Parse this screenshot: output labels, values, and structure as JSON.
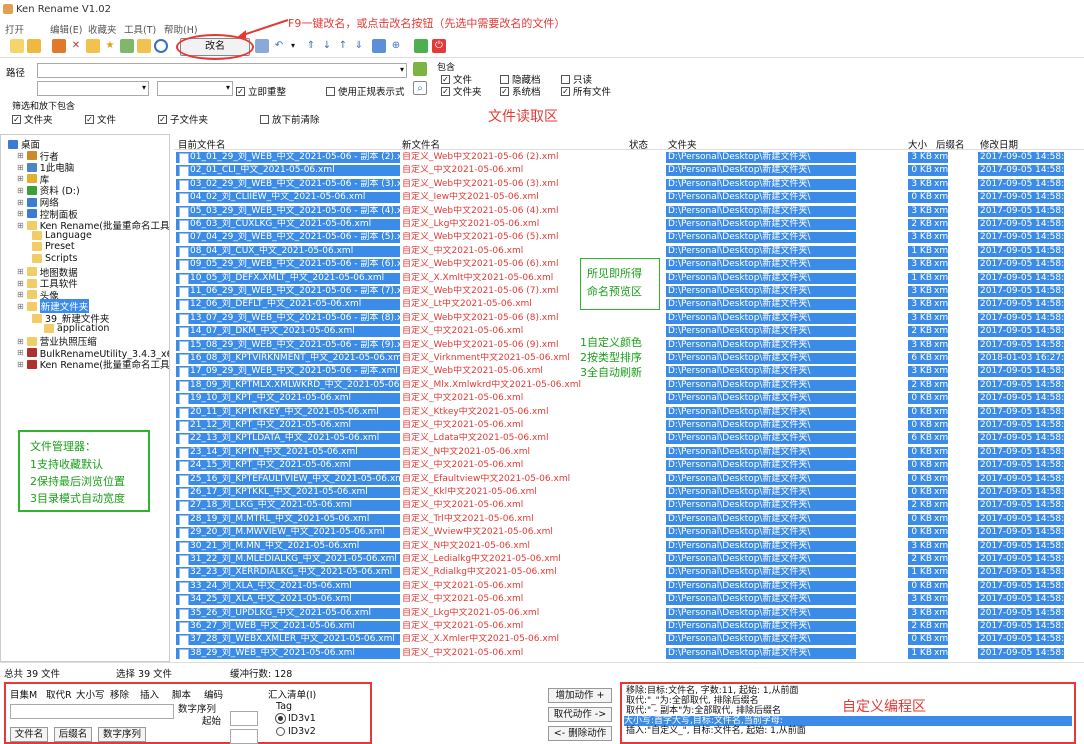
{
  "window": {
    "title": "Ken Rename V1.02"
  },
  "menu": [
    "打开",
    "编辑(E)",
    "收藏夹",
    "工具(T)",
    "帮助(H)"
  ],
  "toolbar": {
    "rename_label": "改名"
  },
  "callouts": {
    "f9": "F9一键改名，或点击改名按钮（先选中需要改名的文件）",
    "read_area": "文件读取区",
    "preview": [
      "所见即所得",
      "命名预览区"
    ],
    "features": [
      "1自定义颜色",
      "2按类型排序",
      "3全自动刷新"
    ],
    "filemgr": [
      "文件管理器：",
      "1支持收藏默认",
      "2保持最后浏览位置",
      "3目录模式自动宽度"
    ],
    "prog_area": "自定义编程区"
  },
  "filter": {
    "path_label": "路径",
    "include_label": "包含",
    "refresh_label": "立即重整",
    "regex_label": "使用正规表示式",
    "sub_include_label": "筛选和放下包含",
    "files_label": "文件夹",
    "file_label": "文件",
    "subfolder_label": "子文件夹",
    "clear_label": "放下前清除",
    "inc_file": "文件",
    "inc_folder": "文件夹",
    "hidden": "隐藏档",
    "system": "系统档",
    "readonly": "只读",
    "allfiles": "所有文件"
  },
  "tree": [
    {
      "label": "桌面",
      "indent": 0,
      "color": "#3b7bd6"
    },
    {
      "label": "行者",
      "indent": 1,
      "color": "#c98a2c"
    },
    {
      "label": "1此电脑",
      "indent": 1,
      "color": "#4a86c8"
    },
    {
      "label": "库",
      "indent": 1,
      "color": "#e0b030"
    },
    {
      "label": "资料 (D:)",
      "indent": 1,
      "color": "#3aa03a"
    },
    {
      "label": "网络",
      "indent": 1,
      "color": "#3b7bd6"
    },
    {
      "label": "控制面板",
      "indent": 1,
      "color": "#3b7bd6"
    },
    {
      "label": "Ken Rename(批量重命名工具中文",
      "indent": 1,
      "color": "#f2cc66"
    },
    {
      "label": "Language",
      "indent": 2,
      "color": "#f2cc66"
    },
    {
      "label": "Preset",
      "indent": 2,
      "color": "#f2cc66"
    },
    {
      "label": "Scripts",
      "indent": 2,
      "color": "#f2cc66"
    },
    {
      "label": "地图数据",
      "indent": 1,
      "color": "#f2cc66"
    },
    {
      "label": "工具软件",
      "indent": 1,
      "color": "#f2cc66"
    },
    {
      "label": "头像",
      "indent": 1,
      "color": "#f2cc66"
    },
    {
      "label": "新建文件夹",
      "indent": 1,
      "color": "#f2cc66",
      "sel": true
    },
    {
      "label": "39_新建文件夹",
      "indent": 2,
      "color": "#f2cc66"
    },
    {
      "label": "application",
      "indent": 3,
      "color": "#f2cc66"
    },
    {
      "label": "营业执照压缩",
      "indent": 1,
      "color": "#f2cc66"
    },
    {
      "label": "BulkRenameUtility_3.4.3_x64(绿",
      "indent": 1,
      "color": "#b03030"
    },
    {
      "label": "Ken Rename(批量重命名工具中文",
      "indent": 1,
      "color": "#b03030"
    }
  ],
  "columns": {
    "old": "目前文件名",
    "new": "新文件名",
    "state": "状态",
    "dir": "文件夹",
    "size": "大小",
    "ext": "后缀名",
    "date": "修改日期"
  },
  "rows": [
    [
      "01_01_29_刘_WEB_中文_2021-05-06 - 副本 (2).xml",
      "自定义_Web中文2021-05-06 (2).xml",
      "3 KB",
      "2017-09-05 14:58:3"
    ],
    [
      "02_01_CLI_中文_2021-05-06.xml",
      "自定义_中文2021-05-06.xml",
      "0 KB",
      "2017-09-05 14:58:3"
    ],
    [
      "03_02_29_刘_WEB_中文_2021-05-06 - 副本 (3).xml",
      "自定义_Web中文2021-05-06 (3).xml",
      "3 KB",
      "2017-09-05 14:58:3"
    ],
    [
      "04_02_刘_CLIIEW_中文_2021-05-06.xml",
      "自定义_Iew中文2021-05-06.xml",
      "0 KB",
      "2017-09-05 14:58:3"
    ],
    [
      "05_03_29_刘_WEB_中文_2021-05-06 - 副本 (4).xml",
      "自定义_Web中文2021-05-06 (4).xml",
      "3 KB",
      "2017-09-05 14:58:3"
    ],
    [
      "06_03_刘_CUXLKG_中文_2021-05-06.xml",
      "自定义_Lkg中文2021-05-06.xml",
      "2 KB",
      "2017-09-05 14:58:3"
    ],
    [
      "07_04_29_刘_WEB_中文_2021-05-06 - 副本 (5).xml",
      "自定义_Web中文2021-05-06 (5).xml",
      "3 KB",
      "2017-09-05 14:58:3"
    ],
    [
      "08_04_刘_CUX_中文_2021-05-06.xml",
      "自定义_中文2021-05-06.xml",
      "1 KB",
      "2017-09-05 14:58:3"
    ],
    [
      "09_05_29_刘_WEB_中文_2021-05-06 - 副本 (6).xml",
      "自定义_Web中文2021-05-06 (6).xml",
      "3 KB",
      "2017-09-05 14:58:3"
    ],
    [
      "10_05_刘_DEFX.XMLT_中文_2021-05-06.xml",
      "自定义_X.Xmlt中文2021-05-06.xml",
      "1 KB",
      "2017-09-05 14:58:3"
    ],
    [
      "11_06_29_刘_WEB_中文_2021-05-06 - 副本 (7).xml",
      "自定义_Web中文2021-05-06 (7).xml",
      "3 KB",
      "2017-09-05 14:58:3"
    ],
    [
      "12_06_刘_DEFLT_中文_2021-05-06.xml",
      "自定义_Lt中文2021-05-06.xml",
      "3 KB",
      "2017-09-05 14:58:3"
    ],
    [
      "13_07_29_刘_WEB_中文_2021-05-06 - 副本 (8).xml",
      "自定义_Web中文2021-05-06 (8).xml",
      "3 KB",
      "2017-09-05 14:58:3"
    ],
    [
      "14_07_刘_DKM_中文_2021-05-06.xml",
      "自定义_中文2021-05-06.xml",
      "2 KB",
      "2017-09-05 14:58:3"
    ],
    [
      "15_08_29_刘_WEB_中文_2021-05-06 - 副本 (9).xml",
      "自定义_Web中文2021-05-06 (9).xml",
      "3 KB",
      "2017-09-05 14:58:3"
    ],
    [
      "16_08_刘_KPTVIRKNMENT_中文_2021-05-06.xml",
      "自定义_Virknment中文2021-05-06.xml",
      "6 KB",
      "2018-01-03 16:27:2"
    ],
    [
      "17_09_29_刘_WEB_中文_2021-05-06 - 副本.xml",
      "自定义_Web中文2021-05-06.xml",
      "3 KB",
      "2017-09-05 14:58:3"
    ],
    [
      "18_09_刘_KPTMLX.XMLWKRD_中文_2021-05-06.xml",
      "自定义_Mlx.Xmlwkrd中文2021-05-06.xml",
      "2 KB",
      "2017-09-05 14:58:3"
    ],
    [
      "19_10_刘_KPT_中文_2021-05-06.xml",
      "自定义_中文2021-05-06.xml",
      "0 KB",
      "2017-09-05 14:58:3"
    ],
    [
      "20_11_刘_KPTKTKEY_中文_2021-05-06.xml",
      "自定义_Ktkey中文2021-05-06.xml",
      "0 KB",
      "2017-09-05 14:58:3"
    ],
    [
      "21_12_刘_KPT_中文_2021-05-06.xml",
      "自定义_中文2021-05-06.xml",
      "0 KB",
      "2017-09-05 14:58:3"
    ],
    [
      "22_13_刘_KPTLDATA_中文_2021-05-06.xml",
      "自定义_Ldata中文2021-05-06.xml",
      "6 KB",
      "2017-09-05 14:58:3"
    ],
    [
      "23_14_刘_KPTN_中文_2021-05-06.xml",
      "自定义_N中文2021-05-06.xml",
      "0 KB",
      "2017-09-05 14:58:3"
    ],
    [
      "24_15_刘_KPT_中文_2021-05-06.xml",
      "自定义_中文2021-05-06.xml",
      "0 KB",
      "2017-09-05 14:58:3"
    ],
    [
      "25_16_刘_KPTEFAULTVIEW_中文_2021-05-06.xml",
      "自定义_Efaultview中文2021-05-06.xml",
      "0 KB",
      "2017-09-05 14:58:3"
    ],
    [
      "26_17_刘_KPTKKL_中文_2021-05-06.xml",
      "自定义_Kkl中文2021-05-06.xml",
      "0 KB",
      "2017-09-05 14:58:3"
    ],
    [
      "27_18_刘_LKG_中文_2021-05-06.xml",
      "自定义_中文2021-05-06.xml",
      "2 KB",
      "2017-09-05 14:58:3"
    ],
    [
      "28_19_刘_M.MTRL_中文_2021-05-06.xml",
      "自定义_Trl中文2021-05-06.xml",
      "0 KB",
      "2017-09-05 14:58:3"
    ],
    [
      "29_20_刘_M.MWVIEW_中文_2021-05-06.xml",
      "自定义_Wview中文2021-05-06.xml",
      "0 KB",
      "2017-09-05 14:58:3"
    ],
    [
      "30_21_刘_M.MN_中文_2021-05-06.xml",
      "自定义_N中文2021-05-06.xml",
      "3 KB",
      "2017-09-05 14:58:3"
    ],
    [
      "31_22_刘_M.MLEDIALKG_中文_2021-05-06.xml",
      "自定义_Ledialkg中文2021-05-06.xml",
      "2 KB",
      "2017-09-05 14:58:3"
    ],
    [
      "32_23_刘_XERRDIALKG_中文_2021-05-06.xml",
      "自定义_Rdialkg中文2021-05-06.xml",
      "1 KB",
      "2017-09-05 14:58:3"
    ],
    [
      "33_24_刘_XLA_中文_2021-05-06.xml",
      "自定义_中文2021-05-06.xml",
      "0 KB",
      "2017-09-05 14:58:3"
    ],
    [
      "34_25_刘_XLA_中文_2021-05-06.xml",
      "自定义_中文2021-05-06.xml",
      "3 KB",
      "2017-09-05 14:58:3"
    ],
    [
      "35_26_刘_UPDLKG_中文_2021-05-06.xml",
      "自定义_Lkg中文2021-05-06.xml",
      "3 KB",
      "2017-09-05 14:58:3"
    ],
    [
      "36_27_刘_WEB_中文_2021-05-06.xml",
      "自定义_中文2021-05-06.xml",
      "2 KB",
      "2017-09-05 14:58:3"
    ],
    [
      "37_28_刘_WEBX.XMLER_中文_2021-05-06.xml",
      "自定义_X.Xmler中文2021-05-06.xml",
      "0 KB",
      "2017-09-05 14:58:3"
    ],
    [
      "38_29_刘_WEB_中文_2021-05-06.xml",
      "自定义_中文2021-05-06.xml",
      "1 KB",
      "2017-09-05 14:58:3"
    ]
  ],
  "row_dir": "D:\\Personal\\Desktop\\新建文件夹\\",
  "row_ext": "xml",
  "status": {
    "total": "总共 39 文件",
    "selected": "选择 39 文件",
    "buffer": "缓冲行数: 128"
  },
  "bottom": {
    "tabs": [
      "目集M",
      "取代R",
      "大小写",
      "移除",
      "插入",
      "脚本",
      "编码"
    ],
    "insert_list": "汇入清单(I)",
    "seq_label": "数字序列",
    "start_label": "起始",
    "tag_label": "Tag",
    "id3v1": "ID3v1",
    "id3v2": "ID3v2",
    "btn_filename": "文件名",
    "btn_ext": "后缀名",
    "btn_seq": "数字序列",
    "add_action": "增加动作 +",
    "replace_action": "取代动作 ->",
    "remove_action": "<- 删除动作"
  },
  "actions": [
    "移除:目标:文件名, 字数:11, 起始: 1,从前面",
    "取代:\"_\"为:全部取代, 排除后缀名",
    "取代:\" - 副本\"为:全部取代, 排除后缀名",
    "大小写:首字大写,目标:文件名,当前字母:",
    "插入:\"自定义_\", 目标:文件名, 起始: 1,从前面"
  ]
}
